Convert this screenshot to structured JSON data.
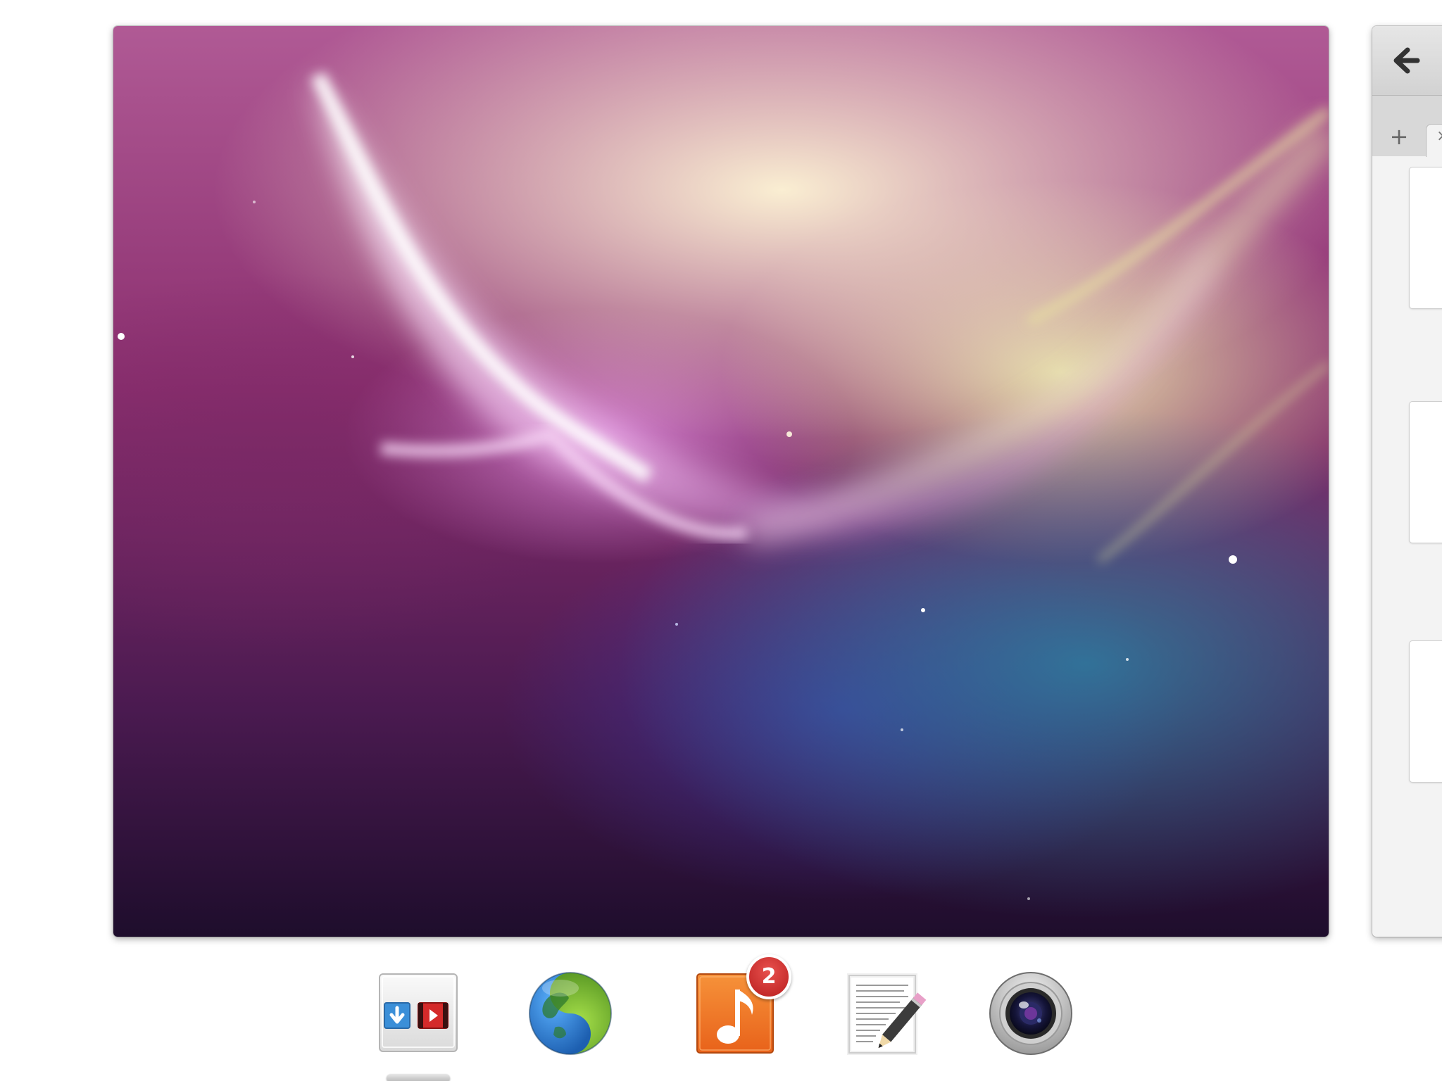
{
  "desktop": {
    "workspace_preview": {
      "name": "workspace-wallpaper-preview"
    }
  },
  "side_window": {
    "back_icon": "arrow-left-icon",
    "back_glyph": "🡐",
    "new_tab_glyph": "+",
    "tab_close_glyph": "×"
  },
  "dock": {
    "items": [
      {
        "name": "multitasking-view-icon",
        "running": true,
        "badge": ""
      },
      {
        "name": "web-browser-icon",
        "running": false,
        "badge": ""
      },
      {
        "name": "music-icon",
        "running": false,
        "badge": "2"
      },
      {
        "name": "text-editor-icon",
        "running": false,
        "badge": ""
      },
      {
        "name": "camera-icon",
        "running": false,
        "badge": ""
      }
    ]
  },
  "colors": {
    "badge": "#c8272a",
    "music_orange": "#f07f2a",
    "browser_blue": "#2a6fc0",
    "browser_green": "#6aa832"
  }
}
